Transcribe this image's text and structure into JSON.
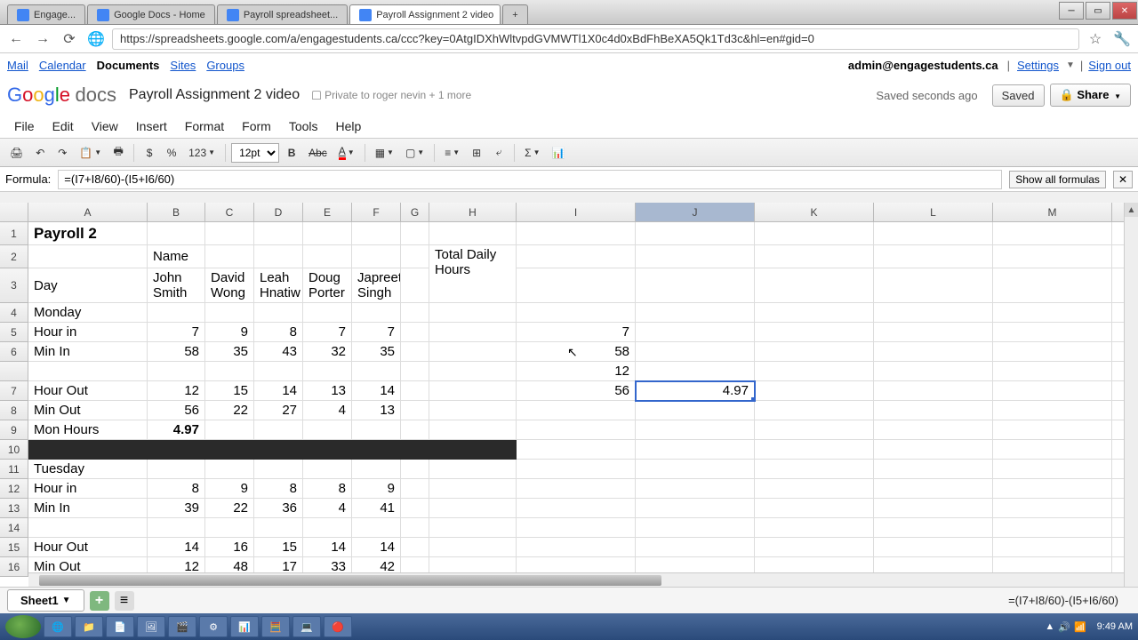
{
  "browser": {
    "tabs": [
      {
        "label": "Engage..."
      },
      {
        "label": "Google Docs - Home"
      },
      {
        "label": "Payroll spreadsheet..."
      },
      {
        "label": "Payroll Assignment 2 video",
        "active": true
      }
    ],
    "url": "https://spreadsheets.google.com/a/engagestudents.ca/ccc?key=0AtgIDXhWltvpdGVMWTl1X0c4d0xBdFhBeXA5Qk1Td3c&hl=en#gid=0"
  },
  "appbar": {
    "links": [
      "Mail",
      "Calendar",
      "Documents",
      "Sites",
      "Groups"
    ],
    "email": "admin@engagestudents.ca",
    "settings": "Settings",
    "signout": "Sign out"
  },
  "docheader": {
    "title": "Payroll Assignment 2 video",
    "privacy": "Private to roger nevin + 1 more",
    "saved_text": "Saved seconds ago",
    "saved_btn": "Saved",
    "share_btn": "Share"
  },
  "menubar": [
    "File",
    "Edit",
    "View",
    "Insert",
    "Format",
    "Form",
    "Tools",
    "Help"
  ],
  "toolbar": {
    "fontsize": "12pt"
  },
  "formula": {
    "label": "Formula:",
    "value": "=(I7+I8/60)-(I5+I6/60)",
    "show_all": "Show all formulas"
  },
  "columns": [
    "A",
    "B",
    "C",
    "D",
    "E",
    "F",
    "G",
    "H",
    "I",
    "J",
    "K",
    "L",
    "M"
  ],
  "sheet": {
    "title": "Payroll 2",
    "name_label": "Name",
    "names": [
      "John Smith",
      "David Wong",
      "Leah Hnatiw",
      "Doug Porter",
      "Japreet Singh"
    ],
    "total_daily": "Total Daily Hours",
    "day_label": "Day",
    "monday": {
      "label": "Monday",
      "hour_in_label": "Hour in",
      "hour_in": [
        7,
        9,
        8,
        7,
        7
      ],
      "min_in_label": "Min In",
      "min_in": [
        58,
        35,
        43,
        32,
        35
      ],
      "hour_out_label": "Hour Out",
      "hour_out": [
        12,
        15,
        14,
        13,
        14
      ],
      "min_out_label": "Min Out",
      "min_out": [
        56,
        22,
        27,
        4,
        13
      ],
      "hours_label": "Mon Hours",
      "hours": "4.97"
    },
    "tuesday": {
      "label": "Tuesday",
      "hour_in_label": "Hour in",
      "hour_in": [
        8,
        9,
        8,
        8,
        9
      ],
      "min_in_label": "Min In",
      "min_in": [
        39,
        22,
        36,
        4,
        41
      ],
      "hour_out_label": "Hour Out",
      "hour_out": [
        14,
        16,
        15,
        14,
        14
      ],
      "min_out_label": "Min Out",
      "min_out": [
        12,
        48,
        17,
        33,
        42
      ]
    },
    "calc_col": {
      "i5": 7,
      "i6": 58,
      "i7": 12,
      "i8": 56,
      "j7": "4.97"
    }
  },
  "sheetbar": {
    "sheet_name": "Sheet1",
    "formula": "=(I7+I8/60)-(I5+I6/60)"
  },
  "taskbar": {
    "time": "9:49 AM",
    "date": ""
  }
}
